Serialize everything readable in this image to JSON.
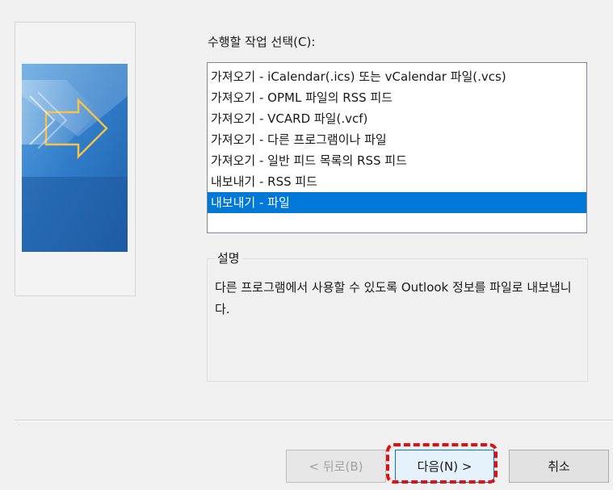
{
  "wizard": {
    "prompt_label": "수행할 작업 선택(C):",
    "actions": [
      "가져오기 - iCalendar(.ics) 또는 vCalendar 파일(.vcs)",
      "가져오기 - OPML 파일의 RSS 피드",
      "가져오기 - VCARD 파일(.vcf)",
      "가져오기 - 다른 프로그램이나 파일",
      "가져오기 - 일반 피드 목록의 RSS 피드",
      "내보내기 - RSS 피드",
      "내보내기 - 파일"
    ],
    "selected_index": 6,
    "description": {
      "title": "설명",
      "text": "다른 프로그램에서 사용할 수 있도록 Outlook 정보를 파일로 내보냅니다."
    }
  },
  "buttons": {
    "back_label": "< 뒤로(B)",
    "next_label": "다음(N) >",
    "cancel_label": "취소"
  },
  "colors": {
    "selection": "#0078d7",
    "highlight": "#e01010",
    "art_blue": "#2a6fb8"
  }
}
